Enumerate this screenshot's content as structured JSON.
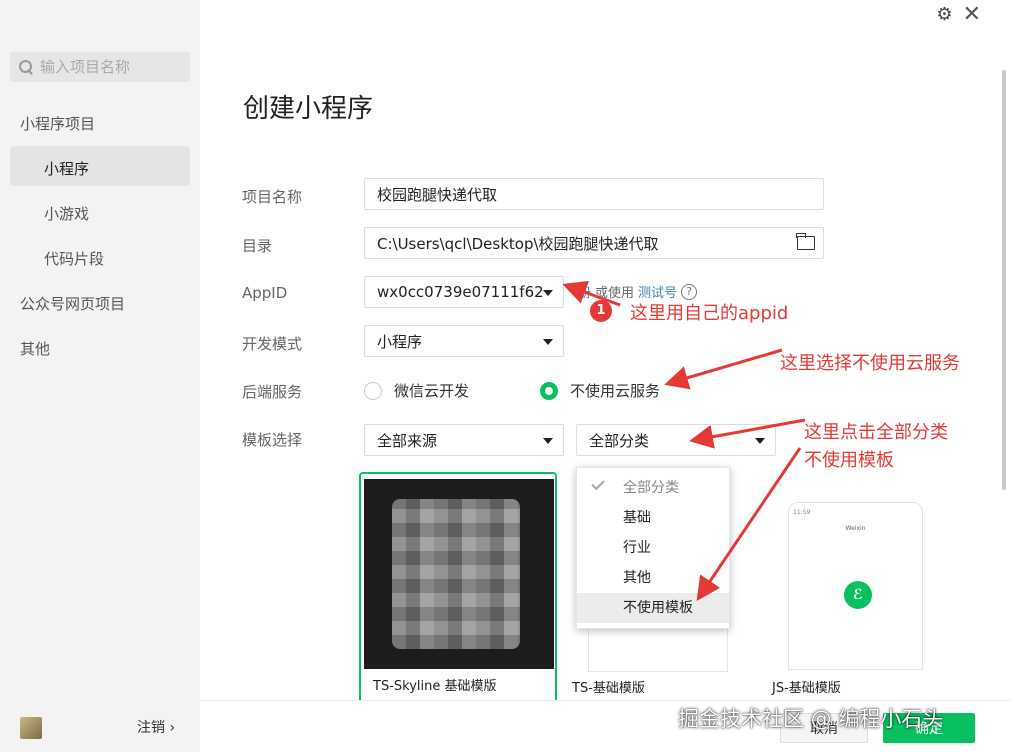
{
  "sidebar": {
    "search_placeholder": "输入项目名称",
    "items": [
      {
        "label": "小程序项目"
      },
      {
        "label": "小程序"
      },
      {
        "label": "小游戏"
      },
      {
        "label": "代码片段"
      },
      {
        "label": "公众号网页项目"
      },
      {
        "label": "其他"
      }
    ],
    "logout": "注销 ›"
  },
  "header": {
    "title": "创建小程序",
    "gear": "⚙",
    "close": "✕"
  },
  "form": {
    "project_name_label": "项目名称",
    "project_name_value": "校园跑腿快递代取",
    "dir_label": "目录",
    "dir_value": "C:\\Users\\qcl\\Desktop\\校园跑腿快递代取",
    "appid_label": "AppID",
    "appid_value": "wx0cc0739e07111f62",
    "appid_hint_prefix": "册",
    "appid_hint_mid": "或使用",
    "appid_hint_link": "测试号",
    "appid_help": "?",
    "devmode_label": "开发模式",
    "devmode_value": "小程序",
    "backend_label": "后端服务",
    "backend_option1": "微信云开发",
    "backend_option2": "不使用云服务",
    "template_label": "模板选择",
    "template_source": "全部来源",
    "template_category": "全部分类"
  },
  "dropdown": {
    "items": [
      "全部分类",
      "基础",
      "行业",
      "其他",
      "不使用模板"
    ]
  },
  "templates": [
    {
      "label": "TS-Skyline 基础模版"
    },
    {
      "label": "TS-基础模版"
    },
    {
      "label": "JS-基础模版"
    }
  ],
  "phone_preview": {
    "status": "11:59",
    "title": "Weixin",
    "logo": "ℰ"
  },
  "annotations": {
    "badge": "1",
    "appid_note": "这里用自己的appid",
    "cloud_note": "这里选择不使用云服务",
    "category_note_line1": "这里点击全部分类",
    "category_note_line2": "不使用模板"
  },
  "footer": {
    "cancel": "取消",
    "ok": "确定"
  },
  "watermark": "掘金技术社区 @ 编程小石头",
  "colors": {
    "accent": "#07c160",
    "annotation": "#e53935",
    "link": "#4a7fb8"
  }
}
